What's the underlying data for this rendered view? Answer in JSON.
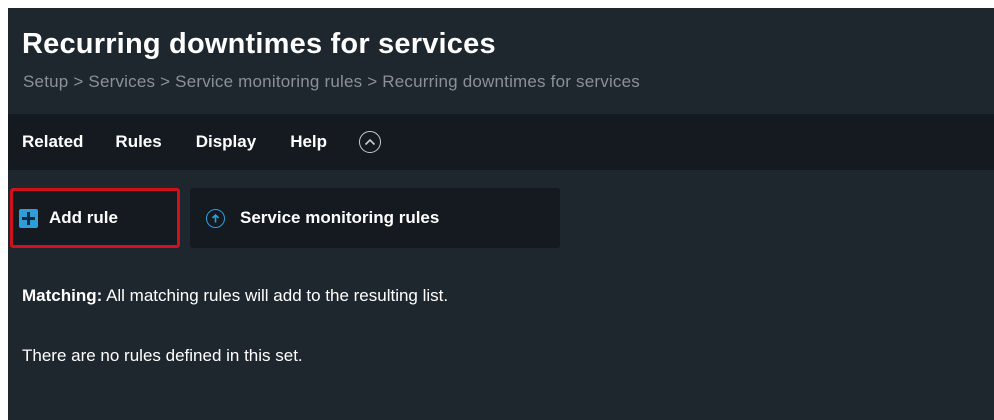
{
  "header": {
    "title": "Recurring downtimes for services",
    "breadcrumb": "Setup > Services > Service monitoring rules > Recurring downtimes for services"
  },
  "menu": {
    "items": [
      {
        "label": "Related"
      },
      {
        "label": "Rules"
      },
      {
        "label": "Display"
      },
      {
        "label": "Help"
      }
    ],
    "collapse_icon": "chevron-up-circle-icon"
  },
  "toolbar": {
    "add_rule_label": "Add rule",
    "add_rule_icon": "plus-icon",
    "service_rules_label": "Service monitoring rules",
    "service_rules_icon": "arrow-up-circle-icon",
    "highlight_color": "#d0101a",
    "accent_color": "#2f9ed8"
  },
  "content": {
    "matching_label": "Matching:",
    "matching_text": " All matching rules will add to the resulting list.",
    "empty_text": "There are no rules defined in this set."
  },
  "colors": {
    "background": "#1e262e",
    "menubar": "#141a20",
    "breadcrumb": "#8a9199"
  }
}
